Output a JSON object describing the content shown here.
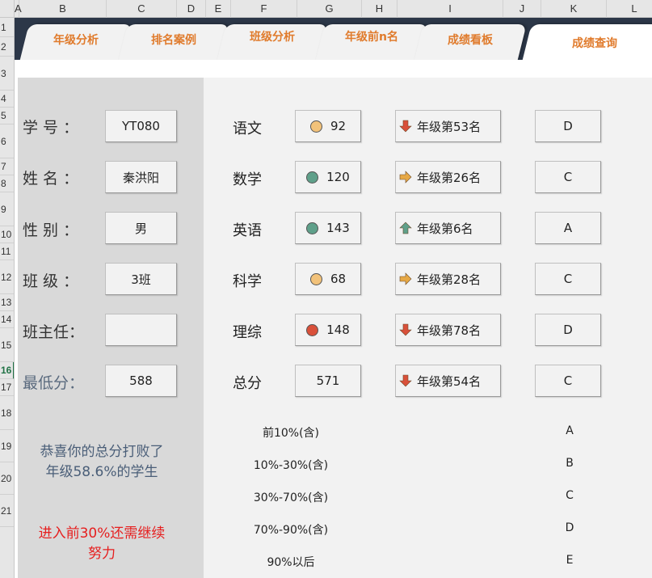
{
  "sheet": {
    "columns": [
      "A",
      "B",
      "C",
      "D",
      "E",
      "F",
      "G",
      "H",
      "I",
      "J",
      "K",
      "L"
    ],
    "rows": [
      "1",
      "2",
      "3",
      "4",
      "5",
      "6",
      "7",
      "8",
      "9",
      "10",
      "11",
      "12",
      "13",
      "14",
      "15",
      "16",
      "17",
      "18",
      "19",
      "20",
      "21"
    ]
  },
  "tabs": [
    {
      "label": "年级分析",
      "active": false
    },
    {
      "label": "排名案例",
      "active": false
    },
    {
      "label": "班级分析",
      "active": false
    },
    {
      "label": "年级前n名",
      "active": false
    },
    {
      "label": "成绩看板",
      "active": false
    },
    {
      "label": "成绩查询",
      "active": true
    }
  ],
  "student": {
    "id_label": "学 号 ：",
    "id_value": "YT080",
    "name_label": "姓 名 ：",
    "name_value": "秦洪阳",
    "gender_label": "性 别 ：",
    "gender_value": "男",
    "class_label": "班 级 ：",
    "class_value": "3班",
    "teacher_label": "班主任：",
    "teacher_value": "",
    "min_label": "最低分：",
    "min_value": "588"
  },
  "scores": [
    {
      "subject": "语文",
      "score": "92",
      "indicator": "#f2c27a",
      "trend": "down",
      "rank": "年级第53名",
      "grade": "D"
    },
    {
      "subject": "数学",
      "score": "120",
      "indicator": "#5fa08a",
      "trend": "right",
      "rank": "年级第26名",
      "grade": "C"
    },
    {
      "subject": "英语",
      "score": "143",
      "indicator": "#5fa08a",
      "trend": "up",
      "rank": "年级第6名",
      "grade": "A"
    },
    {
      "subject": "科学",
      "score": "68",
      "indicator": "#f2c27a",
      "trend": "right",
      "rank": "年级第28名",
      "grade": "C"
    },
    {
      "subject": "理综",
      "score": "148",
      "indicator": "#d9503a",
      "trend": "down",
      "rank": "年级第78名",
      "grade": "D"
    },
    {
      "subject": "总分",
      "score": "571",
      "indicator": "",
      "trend": "down",
      "rank": "年级第54名",
      "grade": "C"
    }
  ],
  "messages": {
    "beat_line1": "恭喜你的总分打败了",
    "beat_line2": "年级58.6%的学生",
    "advance_line1": "进入前30%还需继续",
    "advance_line2": "努力"
  },
  "grade_legend": [
    {
      "range": "前10%(含)",
      "grade": "A"
    },
    {
      "range": "10%-30%(含)",
      "grade": "B"
    },
    {
      "range": "30%-70%(含)",
      "grade": "C"
    },
    {
      "range": "70%-90%(含)",
      "grade": "D"
    },
    {
      "range": "90%以后",
      "grade": "E"
    }
  ],
  "colors": {
    "tab_bar": "#2c3748",
    "tab_text": "#e07b2c",
    "arrow_down": "#d9503a",
    "arrow_right": "#e6a845",
    "arrow_up": "#5fa08a",
    "warning_text": "#e61e1e"
  }
}
